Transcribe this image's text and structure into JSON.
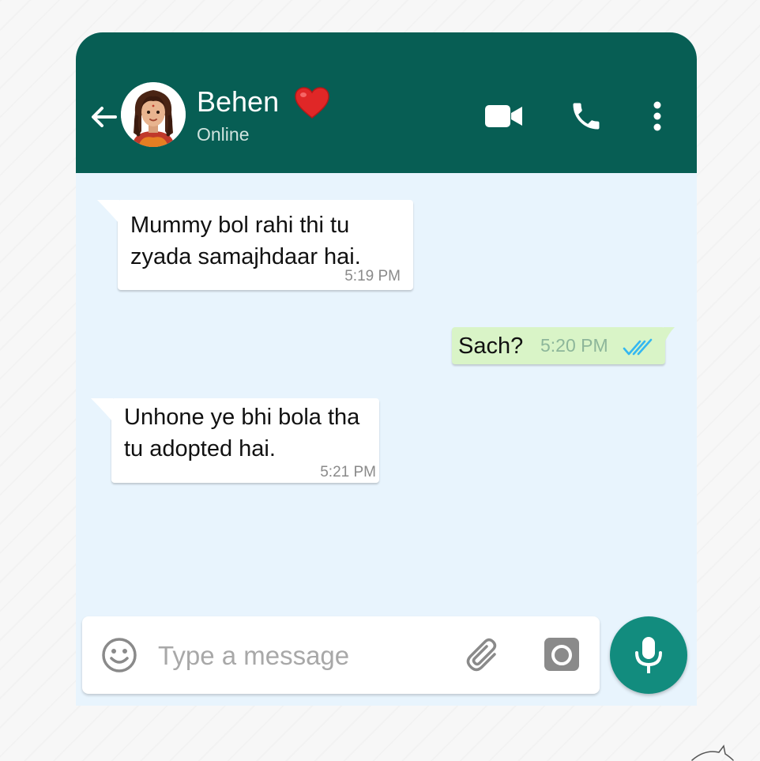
{
  "header": {
    "contact_name": "Behen",
    "status": "Online",
    "icons": [
      "back-arrow-icon",
      "heart-emoji",
      "video-call-icon",
      "voice-call-icon",
      "more-options-icon"
    ]
  },
  "messages": [
    {
      "direction": "incoming",
      "text": "Mummy bol rahi thi tu zyada samajhdaar hai.",
      "time": "5:19 PM"
    },
    {
      "direction": "outgoing",
      "text": "Sach?",
      "time": "5:20 PM",
      "status": "read"
    },
    {
      "direction": "incoming",
      "text": "Unhone ye bhi bola tha tu adopted hai.",
      "time": "5:21 PM"
    }
  ],
  "composer": {
    "placeholder": "Type a message",
    "icons": [
      "emoji-icon",
      "attach-icon",
      "camera-icon",
      "mic-icon"
    ]
  },
  "colors": {
    "header": "#075e54",
    "chat_background": "#e8f4fd",
    "outgoing_bubble": "#d9f4c7",
    "incoming_bubble": "#ffffff",
    "mic_button": "#128c7e",
    "read_ticks": "#34b7f1"
  }
}
